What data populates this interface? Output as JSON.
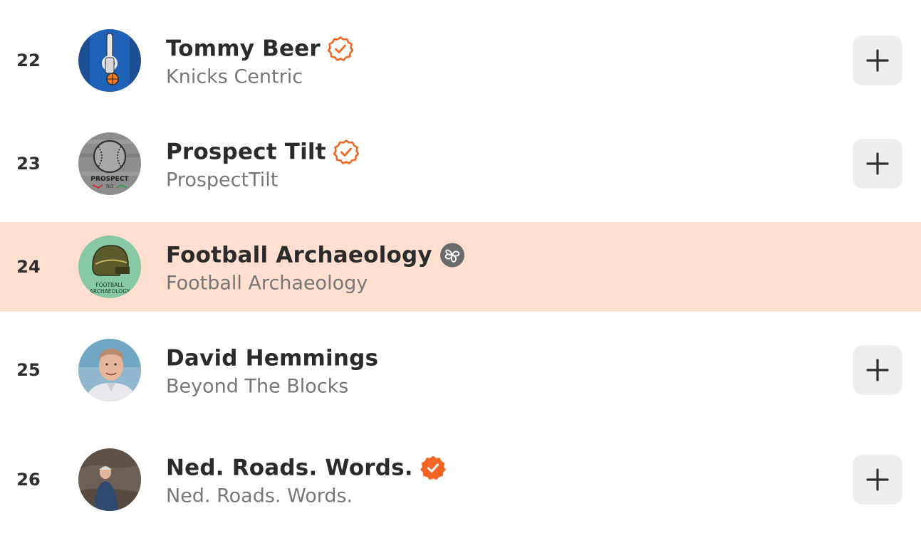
{
  "leaderboard": {
    "rows": [
      {
        "rank": "22",
        "name": "Tommy Beer",
        "publication": "Knicks Centric",
        "badge": "verified-outline-icon",
        "highlighted": false,
        "has_add_button": true,
        "avatar": "basketball-tap-logo"
      },
      {
        "rank": "23",
        "name": "Prospect Tilt",
        "publication": "ProspectTilt",
        "badge": "verified-outline-icon",
        "highlighted": false,
        "has_add_button": true,
        "avatar": "baseball-logo"
      },
      {
        "rank": "24",
        "name": "Football Archaeology",
        "publication": "Football Archaeology",
        "badge": "bestseller-icon",
        "highlighted": true,
        "has_add_button": false,
        "avatar": "football-helmet-logo",
        "avatar_text": [
          "FOOTBALL",
          "ARCHAEOLOGY"
        ]
      },
      {
        "rank": "25",
        "name": "David Hemmings",
        "publication": "Beyond The Blocks",
        "badge": "",
        "highlighted": false,
        "has_add_button": true,
        "avatar": "person-photo"
      },
      {
        "rank": "26",
        "name": "Ned. Roads. Words.",
        "publication": "Ned. Roads. Words.",
        "badge": "verified-filled-icon",
        "highlighted": false,
        "has_add_button": true,
        "avatar": "person-outdoor-photo"
      }
    ]
  },
  "colors": {
    "highlight_bg": "#ffdfd0",
    "accent_orange": "#f26522",
    "badge_gray": "#6b6b6b",
    "button_bg": "#eeeeee"
  },
  "avatar_texts": {
    "prospect": "PROSPECT",
    "tilt": "TILT"
  }
}
